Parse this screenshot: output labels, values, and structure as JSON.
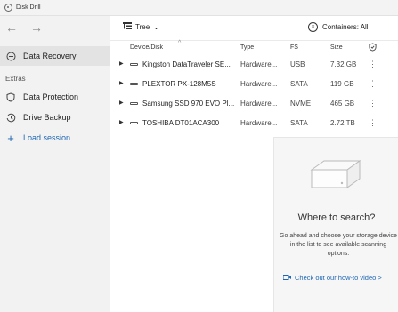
{
  "window": {
    "title": "Disk Drill"
  },
  "sidebar": {
    "back_arrow": "←",
    "forward_arrow": "→",
    "items": [
      {
        "label": "Data Recovery",
        "icon": "recovery-icon",
        "active": true
      }
    ],
    "section_label": "Extras",
    "extras": [
      {
        "label": "Data Protection",
        "icon": "shield-icon"
      },
      {
        "label": "Drive Backup",
        "icon": "clock-backup-icon"
      }
    ],
    "load_session": {
      "plus": "+",
      "label": "Load session..."
    }
  },
  "toolbar": {
    "view_label": "Tree",
    "view_chevron": "⌄",
    "containers_label": "Containers: All"
  },
  "table": {
    "columns": {
      "device": "Device/Disk",
      "type": "Type",
      "fs": "FS",
      "size": "Size"
    },
    "rows": [
      {
        "name": "Kingston DataTraveler SE...",
        "type": "Hardware...",
        "fs": "USB",
        "size": "7.32 GB"
      },
      {
        "name": "PLEXTOR PX-128M5S",
        "type": "Hardware...",
        "fs": "SATA",
        "size": "119 GB"
      },
      {
        "name": "Samsung SSD 970 EVO Pl...",
        "type": "Hardware...",
        "fs": "NVME",
        "size": "465 GB"
      },
      {
        "name": "TOSHIBA DT01ACA300",
        "type": "Hardware...",
        "fs": "SATA",
        "size": "2.72 TB"
      }
    ]
  },
  "info_panel": {
    "title": "Where to search?",
    "text": "Go ahead and choose your storage device in the list to see available scanning options.",
    "link": "Check out our how-to video >"
  },
  "colors": {
    "accent": "#1e66b3",
    "sidebar_bg": "#f2f2f2",
    "selected_bg": "#e3e3e3"
  }
}
